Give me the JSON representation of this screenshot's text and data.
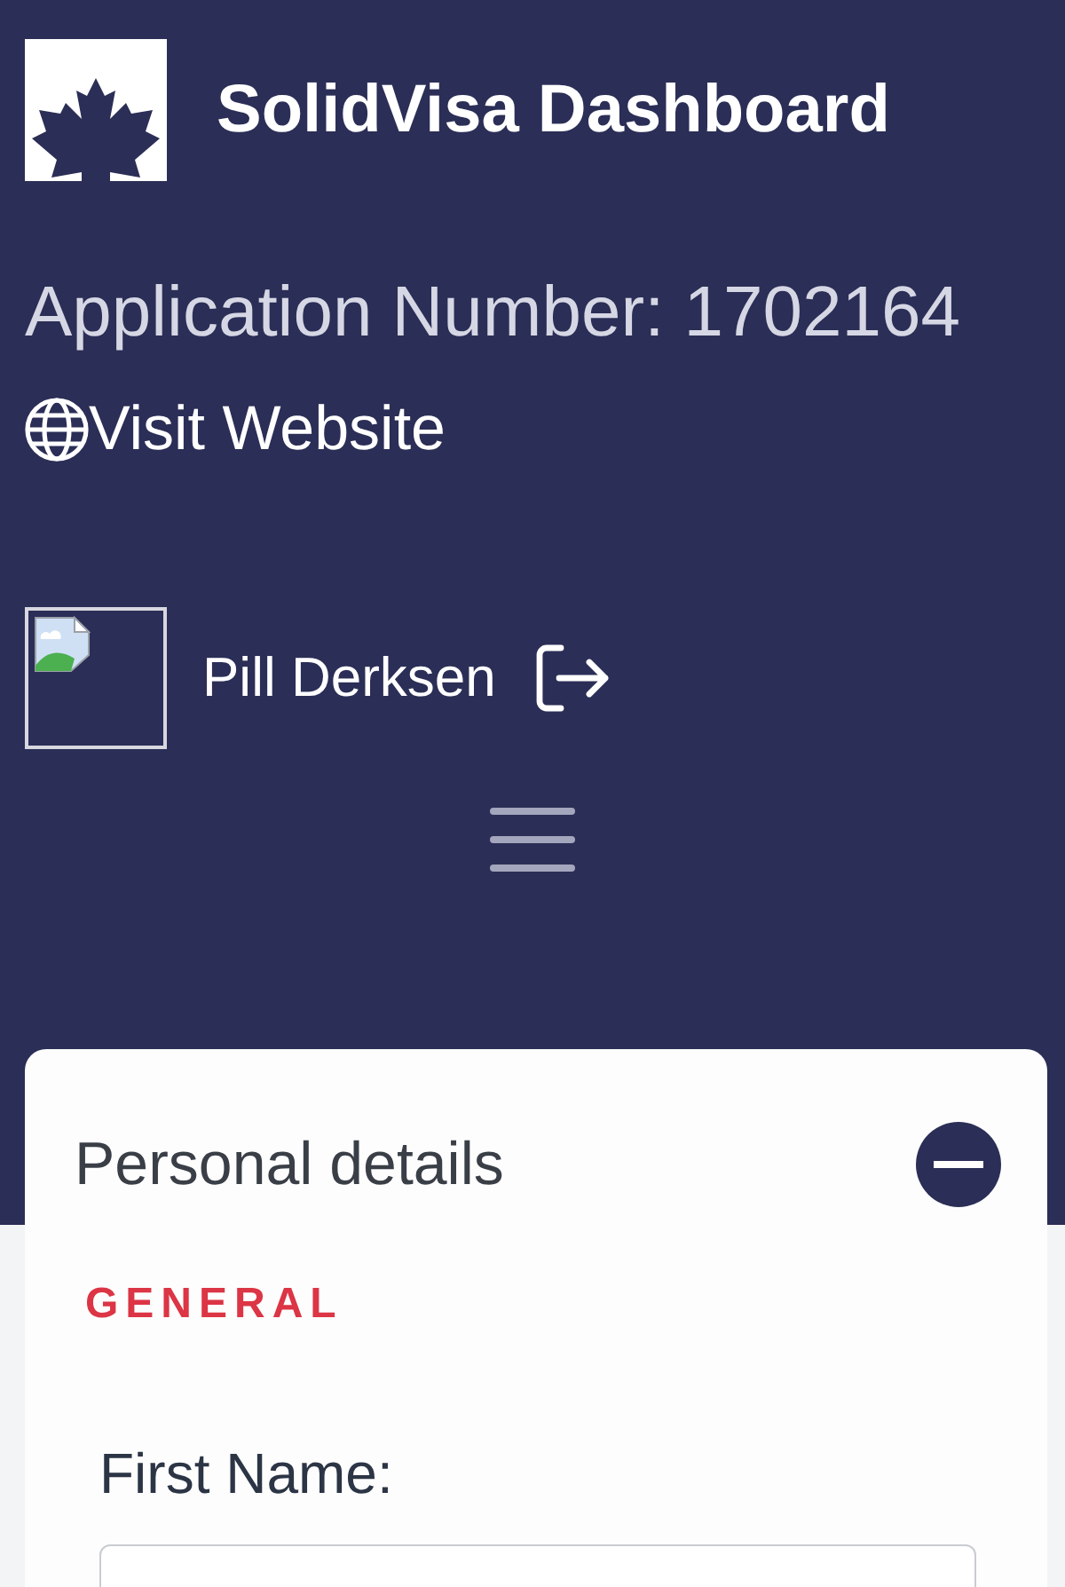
{
  "header": {
    "title": "SolidVisa Dashboard",
    "application_number": "Application Number: 1702164",
    "website_link": "Visit Website"
  },
  "user": {
    "name": "Pill Derksen"
  },
  "section": {
    "title": "Personal details",
    "expanded": true,
    "subsection": "GENERAL",
    "fields": [
      {
        "label": "First Name:"
      }
    ]
  }
}
